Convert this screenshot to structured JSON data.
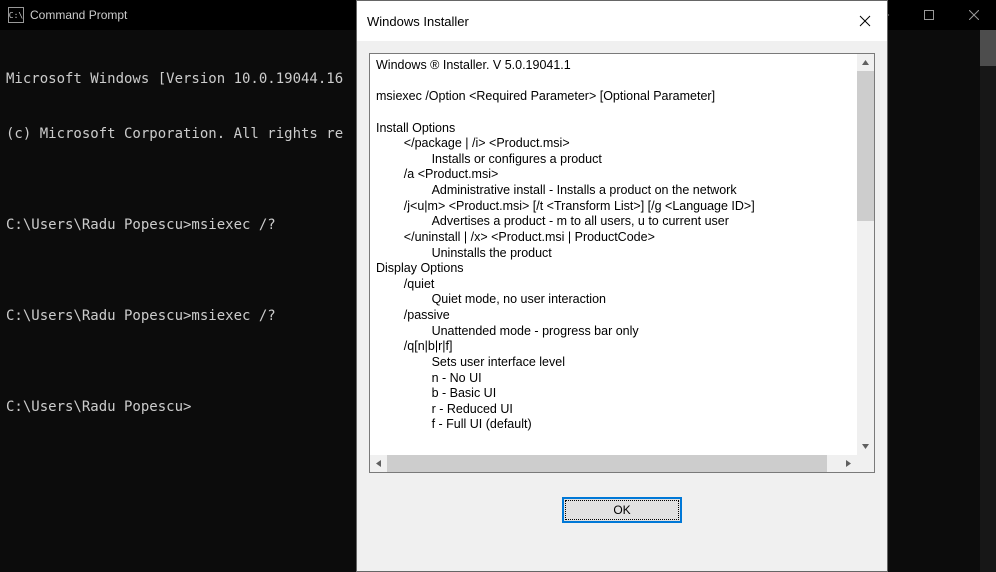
{
  "cmd": {
    "title": "Command Prompt",
    "lines": [
      "Microsoft Windows [Version 10.0.19044.16",
      "(c) Microsoft Corporation. All rights re",
      "",
      "C:\\Users\\Radu Popescu>msiexec /?",
      "",
      "C:\\Users\\Radu Popescu>msiexec /?",
      "",
      "C:\\Users\\Radu Popescu>"
    ]
  },
  "dialog": {
    "title": "Windows Installer",
    "ok": "OK",
    "text": "Windows ® Installer. V 5.0.19041.1 \n\nmsiexec /Option <Required Parameter> [Optional Parameter]\n\nInstall Options\n\t</package | /i> <Product.msi>\n\t\tInstalls or configures a product\n\t/a <Product.msi>\n\t\tAdministrative install - Installs a product on the network\n\t/j<u|m> <Product.msi> [/t <Transform List>] [/g <Language ID>]\n\t\tAdvertises a product - m to all users, u to current user\n\t</uninstall | /x> <Product.msi | ProductCode>\n\t\tUninstalls the product\nDisplay Options\n\t/quiet\n\t\tQuiet mode, no user interaction\n\t/passive\n\t\tUnattended mode - progress bar only\n\t/q[n|b|r|f]\n\t\tSets user interface level\n\t\tn - No UI\n\t\tb - Basic UI\n\t\tr - Reduced UI\n\t\tf - Full UI (default)"
  }
}
